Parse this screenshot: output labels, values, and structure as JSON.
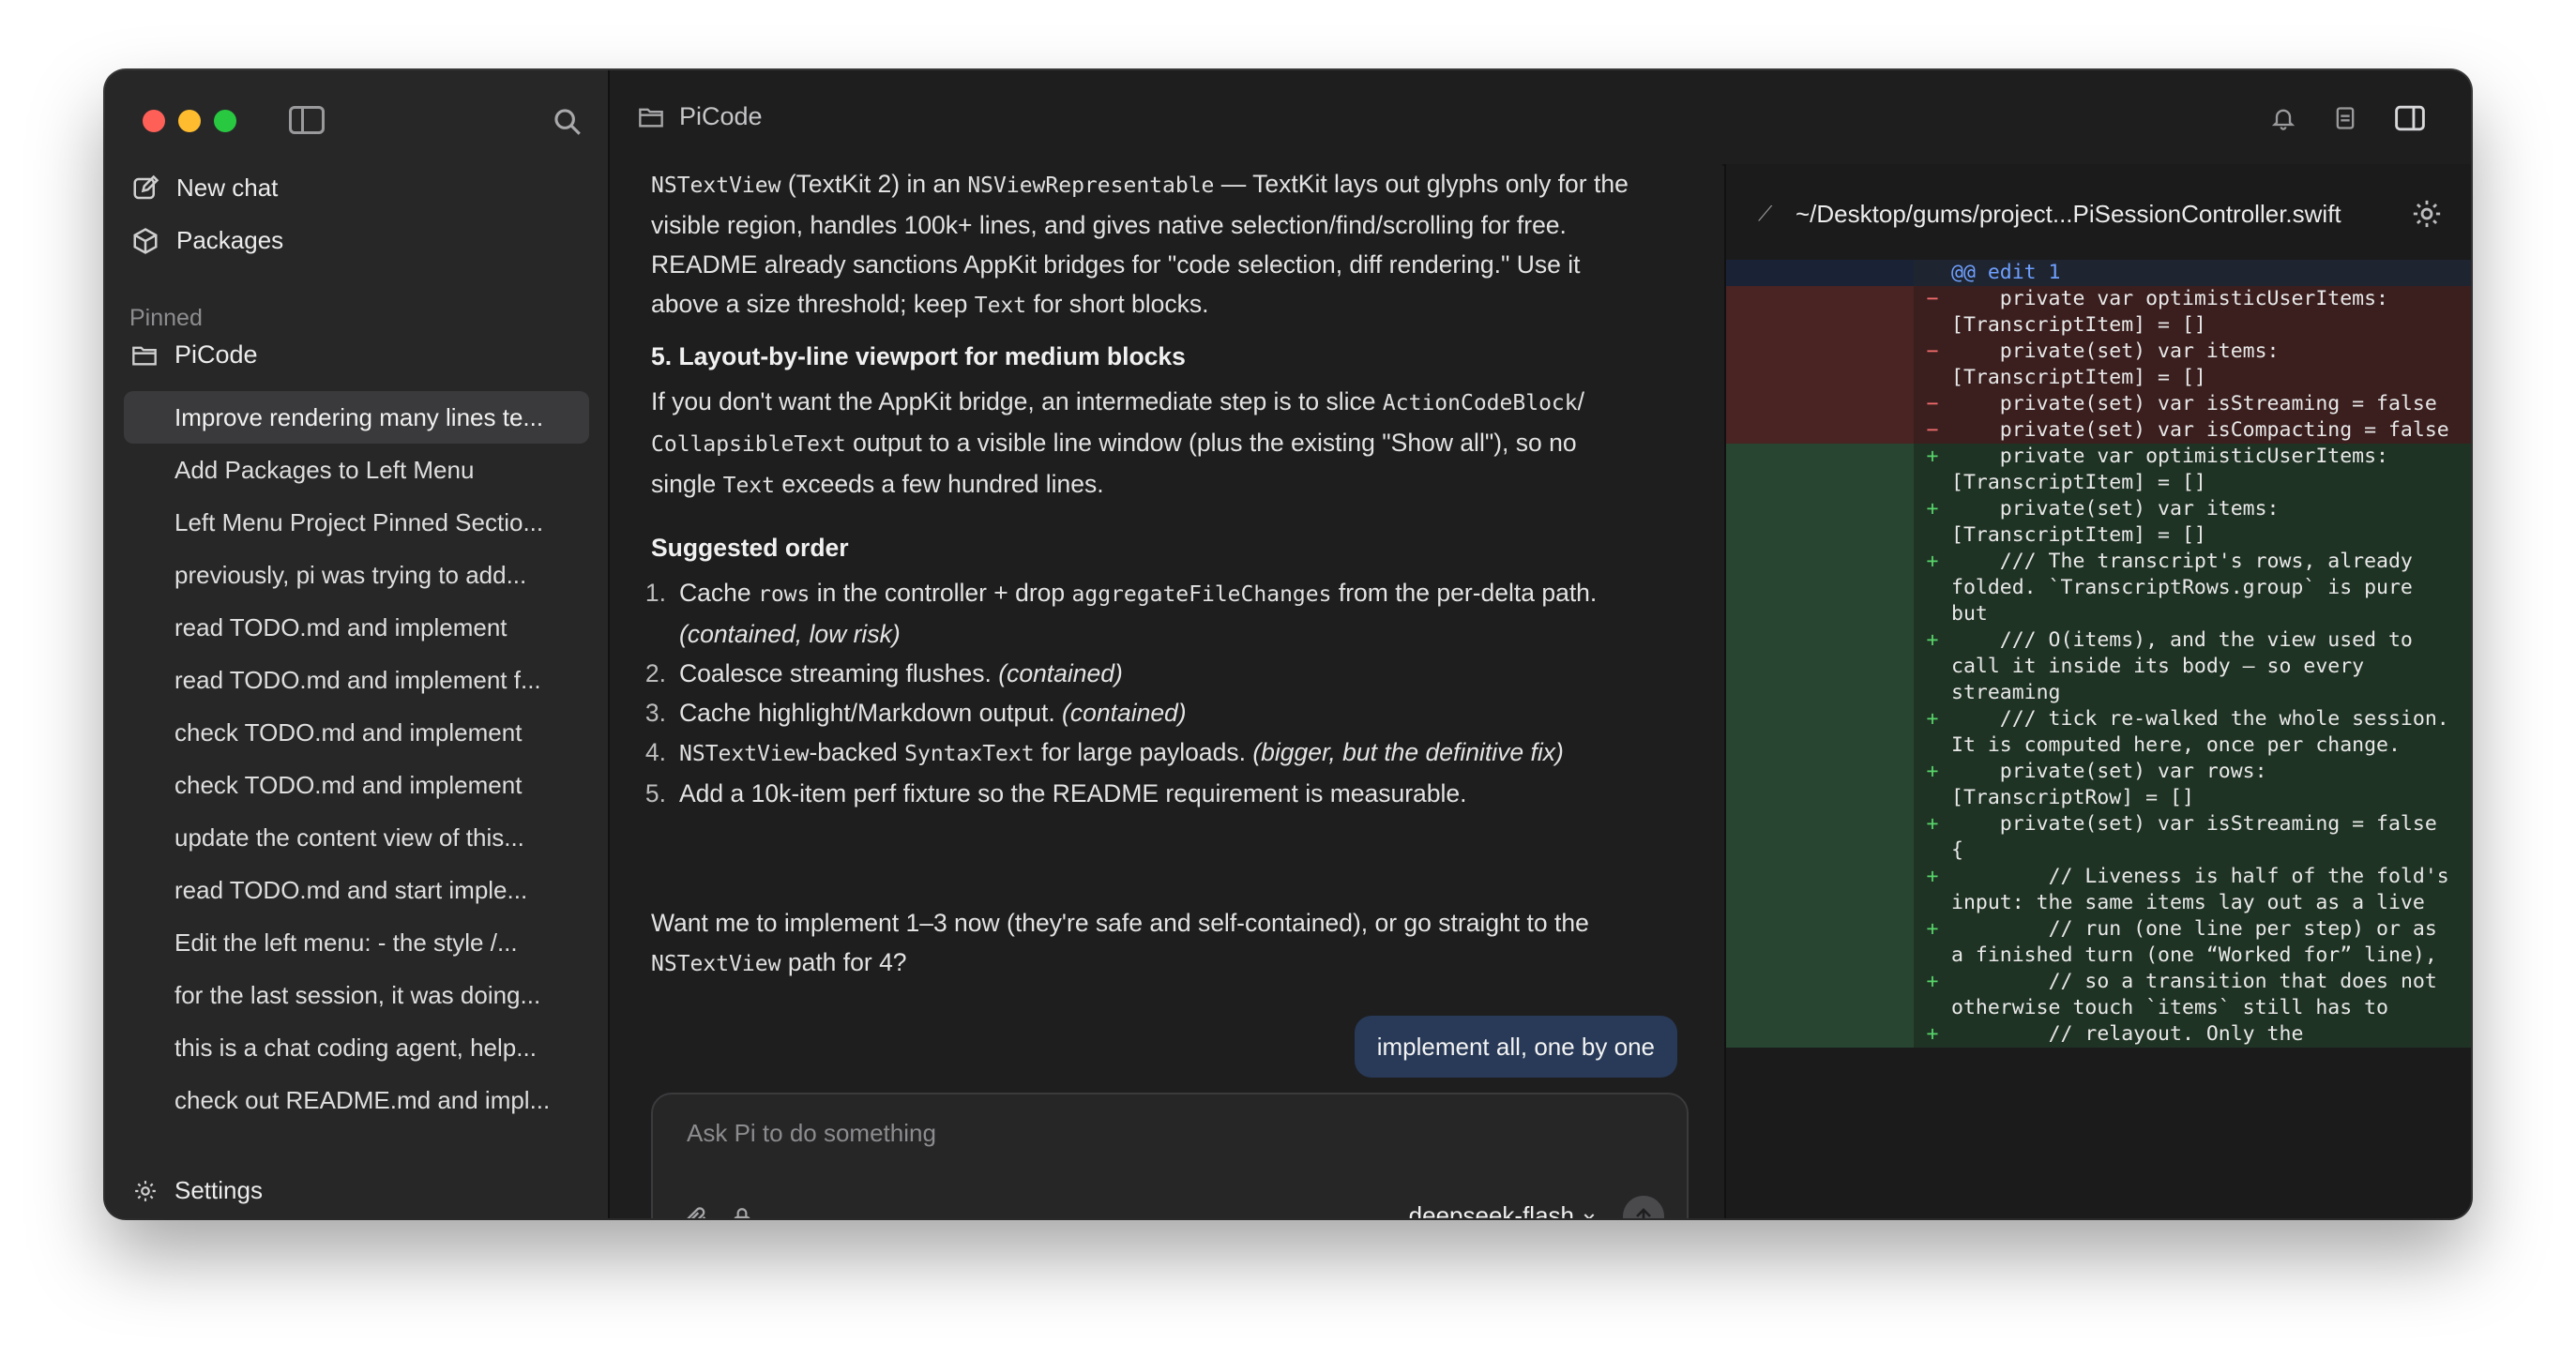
{
  "sidebar": {
    "new_chat": "New chat",
    "packages": "Packages",
    "pinned_label": "Pinned",
    "project": "PiCode",
    "chats": [
      "Improve rendering many lines te...",
      "Add Packages to Left Menu",
      "Left Menu Project Pinned Sectio...",
      "previously, pi was trying to add...",
      "read TODO.md and implement",
      "read TODO.md and implement f...",
      "check TODO.md and implement",
      "check TODO.md and implement",
      "update the content view of this...",
      "read TODO.md and start imple...",
      "Edit the left menu: - the style /...",
      "for the last session, it was doing...",
      "this is a chat coding agent, help...",
      "check out README.md and impl..."
    ],
    "settings": "Settings"
  },
  "header": {
    "project": "PiCode"
  },
  "chat": {
    "p1": {
      "a": "NSTextView",
      "b": " (TextKit 2) in an ",
      "c": "NSViewRepresentable",
      "d": " — TextKit lays out glyphs only for the visible region, handles 100k+ lines, and gives native selection/find/scrolling for free. README already sanctions AppKit bridges for \"code selection, diff rendering.\" Use it above a size threshold; keep ",
      "e": "Text",
      "f": " for short blocks."
    },
    "h5": "5. Layout-by-line viewport for medium blocks",
    "p2": {
      "a": "If you don't want the AppKit bridge, an intermediate step is to slice ",
      "b": "ActionCodeBlock",
      "c": "/ ",
      "d": "CollapsibleText",
      "e": " output to a visible line window (plus the existing \"Show all\"), so no single ",
      "f": "Text",
      "g": " exceeds a few hundred lines."
    },
    "order_heading": "Suggested order",
    "order": [
      {
        "num": "1.",
        "a": "Cache ",
        "b": "rows",
        "c": " in the controller + drop ",
        "d": "aggregateFileChanges",
        "e": " from the per-delta path. ",
        "f": "(contained, low risk)"
      },
      {
        "num": "2.",
        "a": "Coalesce streaming flushes. ",
        "f": "(contained)"
      },
      {
        "num": "3.",
        "a": "Cache highlight/Markdown output. ",
        "f": "(contained)"
      },
      {
        "num": "4.",
        "b": "NSTextView",
        "c": "-backed ",
        "d": "SyntaxText",
        "e": " for large payloads. ",
        "f": "(bigger, but the definitive fix)"
      },
      {
        "num": "5.",
        "a": "Add a 10k-item perf fixture so the README requirement is measurable."
      }
    ],
    "p3": {
      "a": "Want me to implement 1–3 now (they're safe and self-contained), or go straight to the ",
      "b": "NSTextView",
      "c": " path for 4?"
    },
    "user_message": "implement all, one by one"
  },
  "composer": {
    "placeholder": "Ask Pi to do something",
    "model": "deepseek-flash"
  },
  "diff": {
    "path": "~/Desktop/gums/project...PiSessionController.swift",
    "lines": [
      {
        "kind": "hunk",
        "sign": "",
        "text": "@@ edit 1"
      },
      {
        "kind": "del",
        "sign": "−",
        "text": "    private var optimisticUserItems: [TranscriptItem] = []"
      },
      {
        "kind": "del",
        "sign": "−",
        "text": "    private(set) var items: [TranscriptItem] = []"
      },
      {
        "kind": "del",
        "sign": "−",
        "text": "    private(set) var isStreaming = false"
      },
      {
        "kind": "del",
        "sign": "−",
        "text": "    private(set) var isCompacting = false"
      },
      {
        "kind": "add",
        "sign": "+",
        "text": "    private var optimisticUserItems: [TranscriptItem] = []"
      },
      {
        "kind": "add",
        "sign": "+",
        "text": "    private(set) var items: [TranscriptItem] = []"
      },
      {
        "kind": "add",
        "sign": "+",
        "text": "    /// The transcript's rows, already folded. `TranscriptRows.group` is pure but"
      },
      {
        "kind": "add",
        "sign": "+",
        "text": "    /// O(items), and the view used to call it inside its body — so every streaming"
      },
      {
        "kind": "add",
        "sign": "+",
        "text": "    /// tick re-walked the whole session. It is computed here, once per change."
      },
      {
        "kind": "add",
        "sign": "+",
        "text": "    private(set) var rows: [TranscriptRow] = []"
      },
      {
        "kind": "add",
        "sign": "+",
        "text": "    private(set) var isStreaming = false {"
      },
      {
        "kind": "add",
        "sign": "+",
        "text": "        // Liveness is half of the fold's input: the same items lay out as a live"
      },
      {
        "kind": "add",
        "sign": "+",
        "text": "        // run (one line per step) or as a finished turn (one “Worked for” line),"
      },
      {
        "kind": "add",
        "sign": "+",
        "text": "        // so a transition that does not otherwise touch `items` still has to"
      },
      {
        "kind": "add",
        "sign": "+",
        "text": "        // relayout. Only the"
      }
    ]
  }
}
